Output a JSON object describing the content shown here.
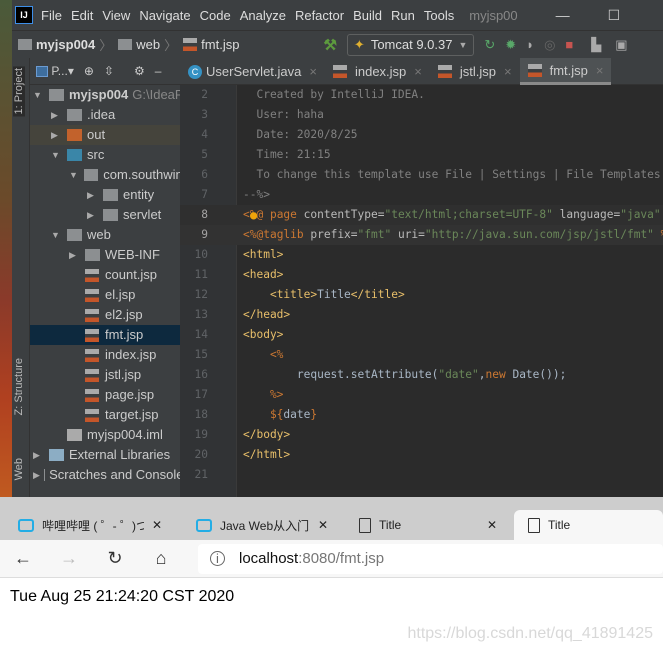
{
  "ide": {
    "logo": "IJ",
    "menu": [
      "File",
      "Edit",
      "View",
      "Navigate",
      "Code",
      "Analyze",
      "Refactor",
      "Build",
      "Run",
      "Tools"
    ],
    "window_title": "myjsp00",
    "breadcrumb": [
      "myjsp004",
      "web",
      "fmt.jsp"
    ],
    "run_config": "Tomcat 9.0.37",
    "side_tabs": [
      "1: Project",
      "Z: Structure",
      "Web"
    ],
    "project_header": "P...",
    "tree": [
      {
        "label": "myjsp004",
        "extra": "G:\\IdeaP",
        "depth": 0,
        "arrow": "down",
        "icon": "module-folder-icon"
      },
      {
        "label": ".idea",
        "depth": 1,
        "arrow": "right",
        "icon": "folder-icon"
      },
      {
        "label": "out",
        "depth": 1,
        "arrow": "right",
        "icon": "excluded-folder-icon"
      },
      {
        "label": "src",
        "depth": 1,
        "arrow": "down",
        "icon": "source-folder-icon"
      },
      {
        "label": "com.southwind",
        "depth": 2,
        "arrow": "down",
        "icon": "package-icon"
      },
      {
        "label": "entity",
        "depth": 3,
        "arrow": "right",
        "icon": "package-icon"
      },
      {
        "label": "servlet",
        "depth": 3,
        "arrow": "right",
        "icon": "package-icon"
      },
      {
        "label": "web",
        "depth": 1,
        "arrow": "down",
        "icon": "web-folder-icon"
      },
      {
        "label": "WEB-INF",
        "depth": 2,
        "arrow": "right",
        "icon": "folder-icon"
      },
      {
        "label": "count.jsp",
        "depth": 2,
        "icon": "jsp-file-icon"
      },
      {
        "label": "el.jsp",
        "depth": 2,
        "icon": "jsp-file-icon"
      },
      {
        "label": "el2.jsp",
        "depth": 2,
        "icon": "jsp-file-icon"
      },
      {
        "label": "fmt.jsp",
        "depth": 2,
        "icon": "jsp-file-icon",
        "selected": true
      },
      {
        "label": "index.jsp",
        "depth": 2,
        "icon": "jsp-file-icon"
      },
      {
        "label": "jstl.jsp",
        "depth": 2,
        "icon": "jsp-file-icon"
      },
      {
        "label": "page.jsp",
        "depth": 2,
        "icon": "jsp-file-icon"
      },
      {
        "label": "target.jsp",
        "depth": 2,
        "icon": "jsp-file-icon"
      },
      {
        "label": "myjsp004.iml",
        "depth": 1,
        "icon": "iml-file-icon"
      },
      {
        "label": "External Libraries",
        "depth": 0,
        "arrow": "right",
        "icon": "library-icon"
      },
      {
        "label": "Scratches and Consoles",
        "depth": 0,
        "arrow": "right",
        "icon": "scratches-icon"
      }
    ],
    "editor_tabs": [
      {
        "label": "UserServlet.java",
        "icon": "java-class-icon"
      },
      {
        "label": "index.jsp",
        "icon": "jsp-file-icon"
      },
      {
        "label": "jstl.jsp",
        "icon": "jsp-file-icon"
      },
      {
        "label": "fmt.jsp",
        "icon": "jsp-file-icon",
        "active": true
      }
    ],
    "current_line": 9,
    "code": [
      {
        "n": 2,
        "tokens": [
          [
            "c",
            "  Created by IntelliJ IDEA."
          ]
        ]
      },
      {
        "n": 3,
        "tokens": [
          [
            "c",
            "  User: haha"
          ]
        ]
      },
      {
        "n": 4,
        "tokens": [
          [
            "c",
            "  Date: 2020/8/25"
          ]
        ]
      },
      {
        "n": 5,
        "tokens": [
          [
            "c",
            "  Time: 21:15"
          ]
        ]
      },
      {
        "n": 6,
        "tokens": [
          [
            "c",
            "  To change this template use File | Settings | File Templates."
          ]
        ]
      },
      {
        "n": 7,
        "tokens": [
          [
            "c",
            "--%>"
          ]
        ]
      },
      {
        "n": 8,
        "tokens": [
          [
            "d",
            "<%@ "
          ],
          [
            "k",
            "page "
          ],
          [
            "a",
            "contentType="
          ],
          [
            "s",
            "\"text/html;charset=UTF-8\" "
          ],
          [
            "a",
            "language="
          ],
          [
            "s",
            "\"java\" "
          ],
          [
            "d",
            "%>"
          ]
        ]
      },
      {
        "n": 9,
        "tokens": [
          [
            "d",
            "<%@"
          ],
          [
            "k",
            "taglib "
          ],
          [
            "a",
            "prefix="
          ],
          [
            "s",
            "\"fmt\" "
          ],
          [
            "a",
            "uri="
          ],
          [
            "s",
            "\"http://java.sun.com/jsp/jstl/fmt\" "
          ],
          [
            "d",
            "%>"
          ]
        ]
      },
      {
        "n": 10,
        "tokens": [
          [
            "t",
            "<html>"
          ]
        ]
      },
      {
        "n": 11,
        "tokens": [
          [
            "t",
            "<head>"
          ]
        ]
      },
      {
        "n": 12,
        "tokens": [
          [
            "p",
            "    "
          ],
          [
            "t",
            "<title>"
          ],
          [
            "p",
            "Title"
          ],
          [
            "t",
            "</title>"
          ]
        ]
      },
      {
        "n": 13,
        "tokens": [
          [
            "t",
            "</head>"
          ]
        ]
      },
      {
        "n": 14,
        "tokens": [
          [
            "t",
            "<body>"
          ]
        ]
      },
      {
        "n": 15,
        "tokens": [
          [
            "d",
            "    <%"
          ]
        ]
      },
      {
        "n": 16,
        "tokens": [
          [
            "p",
            "        request.setAttribute("
          ],
          [
            "s",
            "\"date\""
          ],
          [
            "p",
            ","
          ],
          [
            "k",
            "new "
          ],
          [
            "p",
            "Date());"
          ]
        ]
      },
      {
        "n": 17,
        "tokens": [
          [
            "d",
            "    %>"
          ]
        ]
      },
      {
        "n": 18,
        "tokens": [
          [
            "d",
            "    ${"
          ],
          [
            "p",
            "date"
          ],
          [
            "d",
            "}"
          ]
        ]
      },
      {
        "n": 19,
        "tokens": [
          [
            "t",
            "</body>"
          ]
        ]
      },
      {
        "n": 20,
        "tokens": [
          [
            "t",
            "</html>"
          ]
        ]
      },
      {
        "n": 21,
        "tokens": []
      }
    ]
  },
  "browser": {
    "tabs": [
      {
        "label": "哔哩哔哩 ( ゜- ゜)つロ",
        "icon": "bilibili-icon"
      },
      {
        "label": "Java Web从入门到",
        "icon": "bilibili-icon"
      },
      {
        "label": "Title",
        "icon": "page-icon"
      },
      {
        "label": "Title",
        "icon": "page-icon",
        "active": true
      }
    ],
    "url_host": "localhost",
    "url_rest": ":8080/fmt.jsp",
    "content": "Tue Aug 25 21:24:20 CST 2020",
    "watermark": "https://blog.csdn.net/qq_41891425"
  }
}
